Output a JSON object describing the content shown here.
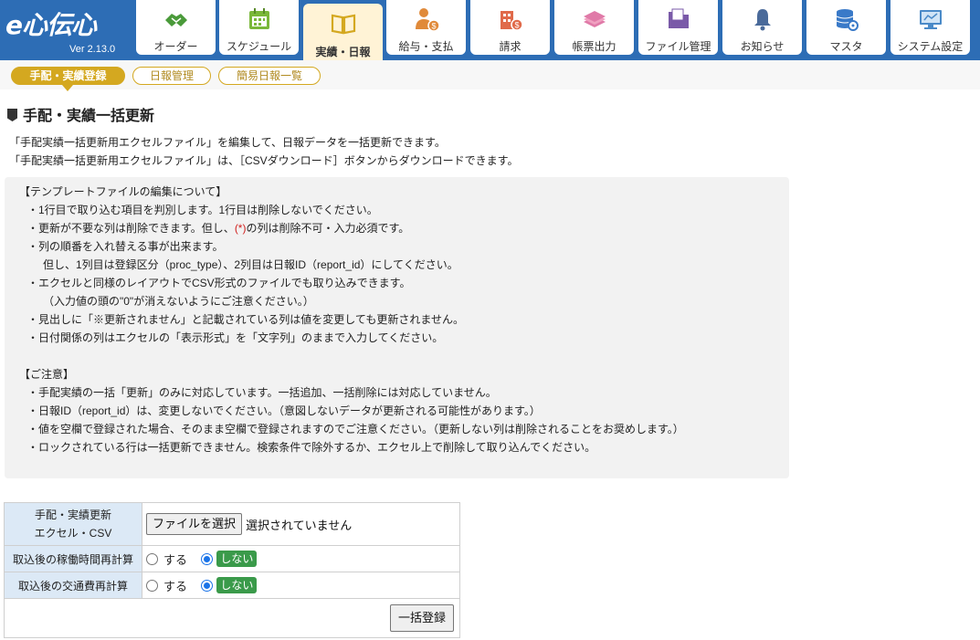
{
  "app": {
    "logo": "e心伝心",
    "version": "Ver 2.13.0"
  },
  "tabs": [
    {
      "label": "オーダー",
      "icon": "handshake-icon"
    },
    {
      "label": "スケジュール",
      "icon": "calendar-icon"
    },
    {
      "label": "実績・日報",
      "icon": "open-book-icon",
      "active": true
    },
    {
      "label": "給与・支払",
      "icon": "person-money-icon"
    },
    {
      "label": "請求",
      "icon": "building-money-icon"
    },
    {
      "label": "帳票出力",
      "icon": "paper-stack-icon"
    },
    {
      "label": "ファイル管理",
      "icon": "folder-icon"
    },
    {
      "label": "お知らせ",
      "icon": "bell-icon"
    },
    {
      "label": "マスタ",
      "icon": "database-gear-icon"
    },
    {
      "label": "システム設定",
      "icon": "monitor-settings-icon"
    }
  ],
  "subnav": [
    "手配・実績登録",
    "日報管理",
    "簡易日報一覧"
  ],
  "page": {
    "title": "手配・実績一括更新",
    "intro": [
      "「手配実績一括更新用エクセルファイル」を編集して、日報データを一括更新できます。",
      "「手配実績一括更新用エクセルファイル」は、［CSVダウンロード］ボタンからダウンロードできます。"
    ]
  },
  "notice": {
    "template_heading": "【テンプレートファイルの編集について】",
    "t1": "・1行目で取り込む項目を判別します。1行目は削除しないでください。",
    "t2_pre": "・更新が不要な列は削除できます。但し、",
    "t2_mark": "(*)",
    "t2_post": "の列は削除不可・入力必須です。",
    "t3": "・列の順番を入れ替える事が出来ます。",
    "t3b": "但し、1列目は登録区分（proc_type）、2列目は日報ID（report_id）にしてください。",
    "t4": "・エクセルと同様のレイアウトでCSV形式のファイルでも取り込みできます。",
    "t4b": "（入力値の頭の\"0\"が消えないようにご注意ください。）",
    "t5": "・見出しに「※更新されません」と記載されている列は値を変更しても更新されません。",
    "t6": "・日付関係の列はエクセルの「表示形式」を「文字列」のままで入力してください。",
    "caution_heading": "【ご注意】",
    "c1": "・手配実績の一括「更新」のみに対応しています。一括追加、一括削除には対応していません。",
    "c2": "・日報ID（report_id）は、変更しないでください。（意図しないデータが更新される可能性があります。）",
    "c3": "・値を空欄で登録された場合、そのまま空欄で登録されますのでご注意ください。（更新しない列は削除されることをお奨めします。）",
    "c4": "・ロックされている行は一括更新できません。検索条件で除外するか、エクセル上で削除して取り込んでください。"
  },
  "form": {
    "file_label_line1": "手配・実績更新",
    "file_label_line2": "エクセル・CSV",
    "file_button": "ファイルを選択",
    "file_status": "選択されていません",
    "recalc_hours_label": "取込後の稼働時間再計算",
    "recalc_transport_label": "取込後の交通費再計算",
    "option_yes": "する",
    "option_no": "しない",
    "submit": "一括登録"
  },
  "colors": {
    "header": "#2d6db5",
    "accent": "#d4a820",
    "active_tab": "#fff3d6",
    "no_tag": "#3a9a4a",
    "required_mark": "#d0201e"
  }
}
